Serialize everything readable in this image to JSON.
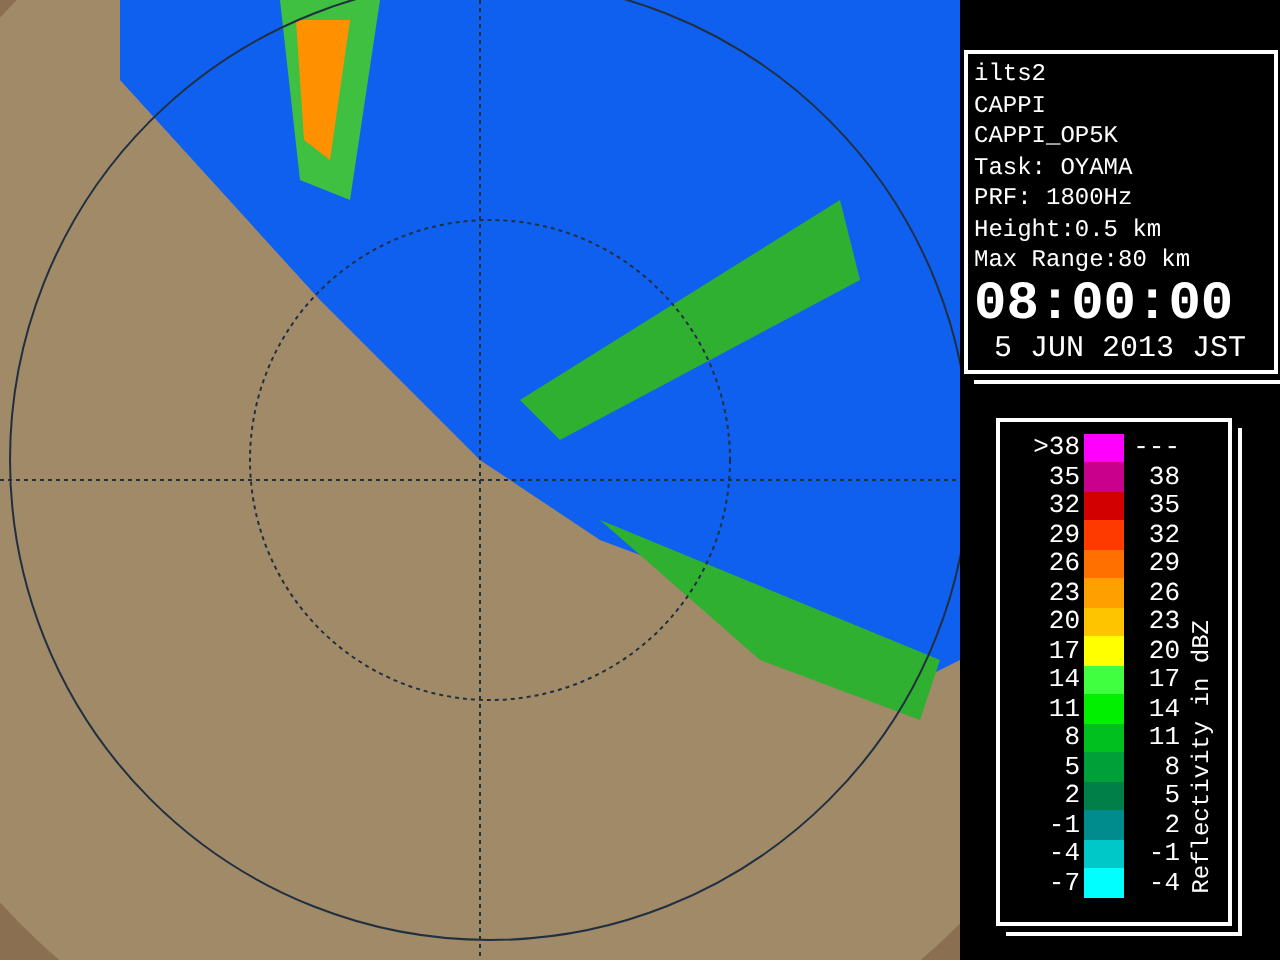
{
  "info": {
    "lines": [
      "ilts2",
      "CAPPI",
      "CAPPI_OP5K",
      "Task: OYAMA",
      "PRF: 1800Hz",
      "Height:0.5 km",
      "Max Range:80 km"
    ],
    "time": "08:00:00",
    "date": "5 JUN 2013 JST"
  },
  "legend": {
    "axis_label": "Reflectivity in dBZ",
    "rows": [
      {
        "lower": ">38",
        "upper": "---",
        "color": "#ff00ff"
      },
      {
        "lower": "35",
        "upper": "38",
        "color": "#c8008c"
      },
      {
        "lower": "32",
        "upper": "35",
        "color": "#d20000"
      },
      {
        "lower": "29",
        "upper": "32",
        "color": "#ff3a00"
      },
      {
        "lower": "26",
        "upper": "29",
        "color": "#ff7000"
      },
      {
        "lower": "23",
        "upper": "26",
        "color": "#ffa000"
      },
      {
        "lower": "20",
        "upper": "23",
        "color": "#ffc400"
      },
      {
        "lower": "17",
        "upper": "20",
        "color": "#ffff00"
      },
      {
        "lower": "14",
        "upper": "17",
        "color": "#40ff40"
      },
      {
        "lower": "11",
        "upper": "14",
        "color": "#00f000"
      },
      {
        "lower": "8",
        "upper": "11",
        "color": "#00c020"
      },
      {
        "lower": "5",
        "upper": "8",
        "color": "#00a038"
      },
      {
        "lower": "2",
        "upper": "5",
        "color": "#008048"
      },
      {
        "lower": "-1",
        "upper": "2",
        "color": "#008c8c"
      },
      {
        "lower": "-4",
        "upper": "-1",
        "color": "#00c8c8"
      },
      {
        "lower": "-7",
        "upper": "-4",
        "color": "#00ffff"
      }
    ]
  }
}
